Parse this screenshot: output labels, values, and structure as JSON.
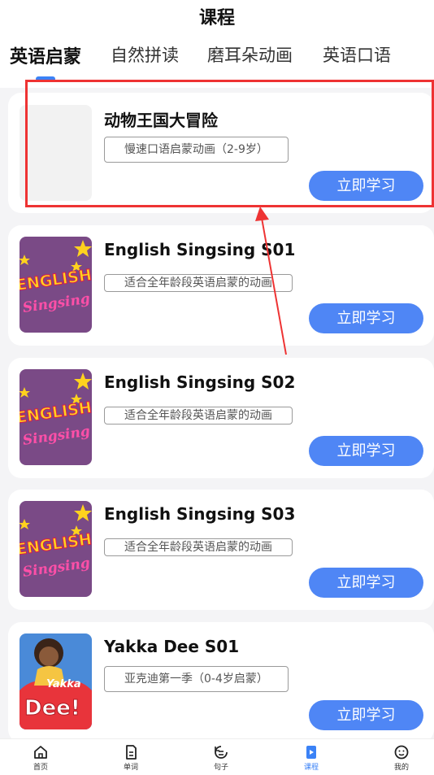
{
  "header": {
    "title": "课程"
  },
  "tabs": [
    {
      "label": "英语启蒙",
      "active": true
    },
    {
      "label": "自然拼读"
    },
    {
      "label": "磨耳朵动画"
    },
    {
      "label": "英语口语"
    }
  ],
  "courses": [
    {
      "title": "动物王国大冒险",
      "tag": "慢速口语启蒙动画（2-9岁）",
      "button": "立即学习",
      "cover": "blank"
    },
    {
      "title": "English Singsing S01",
      "tag": "适合全年龄段英语启蒙的动画",
      "button": "立即学习",
      "cover": "singsing-cover",
      "cover_text": [
        "ENGLISH",
        "Singsing"
      ]
    },
    {
      "title": "English Singsing S02",
      "tag": "适合全年龄段英语启蒙的动画",
      "button": "立即学习",
      "cover": "singsing-cover",
      "cover_text": [
        "ENGLISH",
        "Singsing"
      ]
    },
    {
      "title": "English Singsing S03",
      "tag": "适合全年龄段英语启蒙的动画",
      "button": "立即学习",
      "cover": "singsing-cover",
      "cover_text": [
        "ENGLISH",
        "Singsing"
      ]
    },
    {
      "title": "Yakka Dee S01",
      "tag": "亚克迪第一季（0-4岁启蒙）",
      "button": "立即学习",
      "cover": "yakka-dee-cover",
      "cover_text": [
        "Yakka",
        "Dee!"
      ]
    }
  ],
  "bottom_nav": [
    {
      "label": "首页",
      "icon": "home-icon"
    },
    {
      "label": "单词",
      "icon": "word-icon"
    },
    {
      "label": "句子",
      "icon": "sentence-icon"
    },
    {
      "label": "课程",
      "icon": "course-icon",
      "active": true
    },
    {
      "label": "我的",
      "icon": "profile-icon"
    }
  ],
  "colors": {
    "accent": "#4f86f5",
    "annotation": "#e33333",
    "singsing_bg": "#7a4a86"
  }
}
